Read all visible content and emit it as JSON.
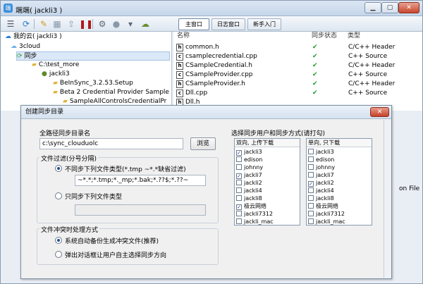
{
  "window": {
    "title": "端端( jackli3 )",
    "icon_glyph": "端"
  },
  "toolbar": {
    "tabs": [
      "主窗口",
      "日志窗口",
      "新手入门"
    ]
  },
  "tree": {
    "nodes": [
      {
        "label": "我的云( jackli3 )",
        "icon": "cloud-icon"
      },
      {
        "label": "3cloud",
        "icon": "cloud-icon"
      },
      {
        "label": "同步",
        "icon": "sync-icon"
      },
      {
        "label": "C:\\test_more",
        "icon": "folder-icon"
      },
      {
        "label": "jackli3",
        "icon": "user-icon"
      },
      {
        "label": "BeInSync_3.2.53.Setup",
        "icon": "folder-icon"
      },
      {
        "label": "Beta 2 Credential Provider Sample",
        "icon": "folder-icon"
      },
      {
        "label": "SampleAllControlsCredentialPr",
        "icon": "folder-icon"
      }
    ]
  },
  "filelist": {
    "headers": {
      "name": "名称",
      "status": "同步状态",
      "type": "类型"
    },
    "rows": [
      {
        "name": "common.h",
        "type": "C/C++ Header"
      },
      {
        "name": "csamplecredential.cpp",
        "type": "C++ Source"
      },
      {
        "name": "CSampleCredential.h",
        "type": "C/C++ Header"
      },
      {
        "name": "CSampleProvider.cpp",
        "type": "C++ Source"
      },
      {
        "name": "CSampleProvider.h",
        "type": "C/C++ Header"
      },
      {
        "name": "Dll.cpp",
        "type": "C++ Source"
      },
      {
        "name": "Dll.h",
        "type": ""
      }
    ],
    "tail_text": "on File"
  },
  "dialog": {
    "title": "创建同步目录",
    "close_label": "✕",
    "path_label": "全路径同步目录名",
    "path_value": "c:\\sync_clouduolc",
    "browse_label": "浏览",
    "filter_group": {
      "title": "文件过滤(分号分隔)",
      "opt_exclude": "不同步下列文件类型(*.tmp ~*.*缺省过滤)",
      "exclude_value": "~*.*;*.tmp;*._mp;*.bak;*.??$;*.??~",
      "opt_include": "只同步下列文件类型",
      "include_value": ""
    },
    "conflict_group": {
      "title": "文件冲突时处理方式",
      "opt_auto": "系统自动备份生成冲突文件(推荐)",
      "opt_ask": "弹出对话框让用户自主选择同步方向"
    },
    "users_label": "选择同步用户和同步方式(请打勾)",
    "bidirectional": {
      "header": "双向, 上传下载",
      "items": [
        {
          "name": "jackli3",
          "checked": true
        },
        {
          "name": "edison",
          "checked": false
        },
        {
          "name": "johnny",
          "checked": false
        },
        {
          "name": "jackli7",
          "checked": true
        },
        {
          "name": "jackli2",
          "checked": false
        },
        {
          "name": "jackli4",
          "checked": false
        },
        {
          "name": "jackli8",
          "checked": false
        },
        {
          "name": "极云网络",
          "checked": true
        },
        {
          "name": "jackli7312",
          "checked": false
        },
        {
          "name": "jackli_mac",
          "checked": false
        }
      ]
    },
    "unidirectional": {
      "header": "单向, 只下载",
      "items": [
        {
          "name": "jackli3",
          "checked": false
        },
        {
          "name": "edison",
          "checked": false
        },
        {
          "name": "johnny",
          "checked": false
        },
        {
          "name": "jackli7",
          "checked": false
        },
        {
          "name": "jackli2",
          "checked": true
        },
        {
          "name": "jackli4",
          "checked": false
        },
        {
          "name": "jackli8",
          "checked": false
        },
        {
          "name": "极云网络",
          "checked": false
        },
        {
          "name": "jackli7312",
          "checked": false
        },
        {
          "name": "jackli_mac",
          "checked": false
        }
      ]
    }
  },
  "colors": {
    "accent": "#3c8fd8",
    "check": "#1b9d2a"
  }
}
